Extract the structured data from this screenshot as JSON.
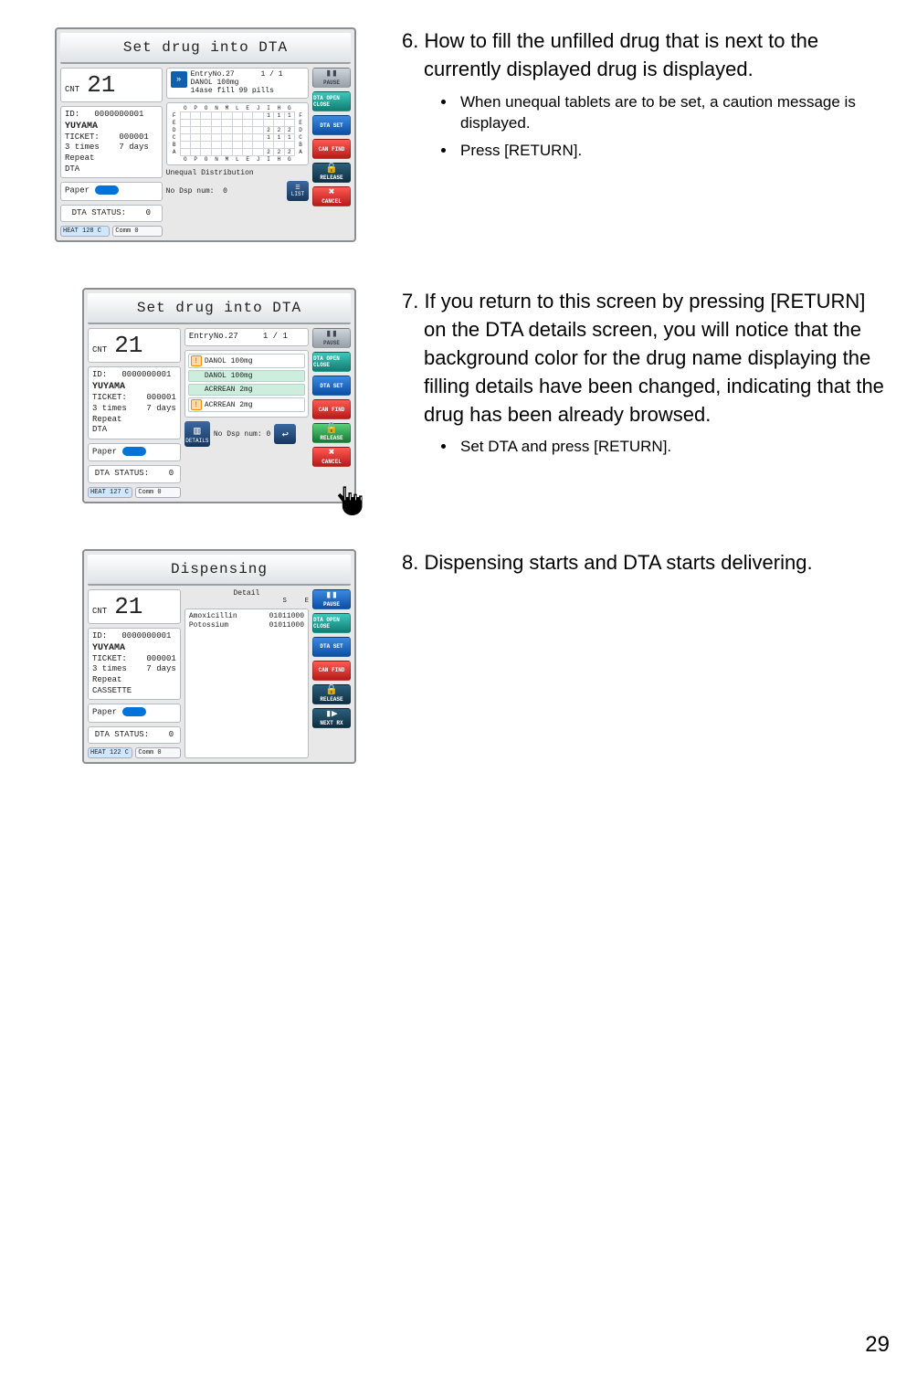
{
  "page_number": "29",
  "steps": {
    "s6": {
      "main": "6. How to fill the unfilled drug that is next to the currently displayed drug is displayed.",
      "subs": [
        "When unequal tablets are to be set, a caution message is displayed.",
        "Press [RETURN]."
      ]
    },
    "s7": {
      "main": "7. If you return to this screen by pressing [RETURN] on the DTA details screen, you will notice that the background color for the drug name displaying the filling details have been changed, indicating that the drug has been already browsed.",
      "subs": [
        "Set DTA and press [RETURN]."
      ]
    },
    "s8": {
      "main": "8. Dispensing starts and DTA starts delivering.",
      "subs": []
    }
  },
  "side_buttons": {
    "pause": "PAUSE",
    "dta_open": "DTA OPEN CLOSE",
    "dta_set": "DTA SET",
    "can_find": "CAN FIND",
    "release": "RELEASE",
    "cancel": "CANCEL",
    "next_rx": "NEXT RX"
  },
  "ss1": {
    "title": "Set  drug into DTA",
    "cnt_label": "CNT",
    "cnt_value": "21",
    "id_line": "ID:   0000000001",
    "name": "YUYAMA",
    "ticket_line": "TICKET:    000001",
    "times_line": "3 times    7 days",
    "repeat": "Repeat",
    "dta": "DTA",
    "paper": "Paper",
    "dta_status": "DTA STATUS:    0",
    "heat": "HEAT 128  C",
    "comm": "Comm 0",
    "entry_hdr": "EntryNo.27      1 / 1\nDANOL 100mg\n14ase fill 99 pills",
    "grid_cols": [
      "O",
      "P",
      "O",
      "N",
      "M",
      "L",
      "E",
      "J",
      "I",
      "H",
      "G"
    ],
    "grid_rows": [
      "F",
      "E",
      "D",
      "C",
      "B",
      "A"
    ],
    "grid_values_note": "cells show small numbers 1 and 2 in a few positions",
    "unequal": "Unequal Distribution",
    "no_dsp": "No Dsp num:  0",
    "list_label": "LIST"
  },
  "ss2": {
    "title": "Set  drug into DTA",
    "cnt_label": "CNT",
    "cnt_value": "21",
    "id_line": "ID:   0000000001",
    "name": "YUYAMA",
    "ticket_line": "TICKET:    000001",
    "times_line": "3 times    7 days",
    "repeat": "Repeat",
    "dta": "DTA",
    "paper": "Paper",
    "dta_status": "DTA STATUS:    0",
    "heat": "HEAT 127  C",
    "comm": "Comm 0",
    "entry_label": "EntryNo.27     1 / 1",
    "drugs": [
      {
        "name": "DANOL 100mg",
        "warn": true,
        "browsed": false
      },
      {
        "name": "DANOL 100mg",
        "warn": false,
        "browsed": true
      },
      {
        "name": "ACRREAN 2mg",
        "warn": false,
        "browsed": true
      },
      {
        "name": "ACRREAN 2mg",
        "warn": true,
        "browsed": false
      }
    ],
    "no_dsp": "No Dsp num:  0",
    "details_label": "DETAILS"
  },
  "ss3": {
    "title": "Dispensing",
    "cnt_label": "CNT",
    "cnt_value": "21",
    "id_line": "ID:   0000000001",
    "name": "YUYAMA",
    "ticket_line": "TICKET:    000001",
    "times_line": "3 times    7 days",
    "repeat": "Repeat",
    "cassette": "CASSETTE",
    "paper": "Paper",
    "dta_status": "DTA STATUS:    0",
    "heat": "HEAT 122  C",
    "comm": "Comm 0",
    "detail_label": "Detail",
    "col_s": "S",
    "col_e": "E",
    "rows": [
      {
        "l1": "Amoxicillin",
        "l2": "Potossium",
        "code1": "01011000",
        "code2": "01011000"
      }
    ]
  }
}
